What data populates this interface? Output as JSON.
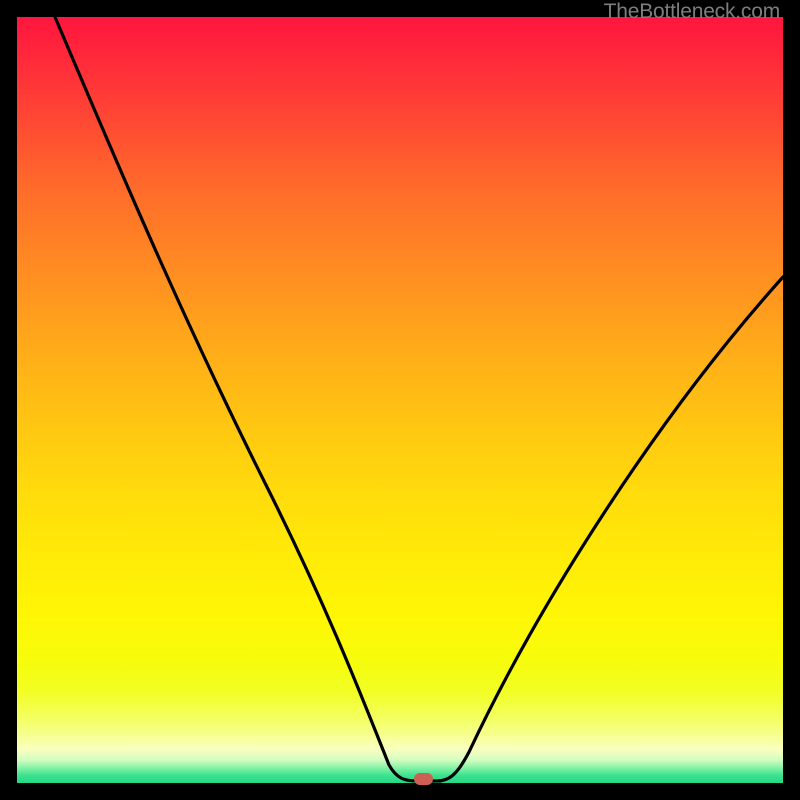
{
  "attribution": "TheBottleneck.com",
  "chart_data": {
    "type": "line",
    "title": "",
    "xlabel": "",
    "ylabel": "",
    "xlim": [
      0,
      100
    ],
    "ylim": [
      0,
      100
    ],
    "series": [
      {
        "name": "bottleneck-curve",
        "x": [
          5,
          10,
          15,
          20,
          25,
          30,
          35,
          40,
          45,
          48,
          50,
          52,
          54,
          56,
          60,
          65,
          70,
          75,
          80,
          85,
          90,
          95,
          100
        ],
        "y": [
          100,
          88,
          76,
          65,
          54,
          44,
          34,
          24,
          12,
          3,
          0,
          0,
          0,
          2,
          8,
          16,
          24,
          32,
          40,
          47,
          54,
          60,
          66
        ]
      }
    ],
    "marker": {
      "x": 53,
      "y": 0,
      "color": "#ce5f55"
    },
    "background_gradient": {
      "top": "#ff163f",
      "mid": "#ffea08",
      "bottom": "#22d985"
    }
  }
}
